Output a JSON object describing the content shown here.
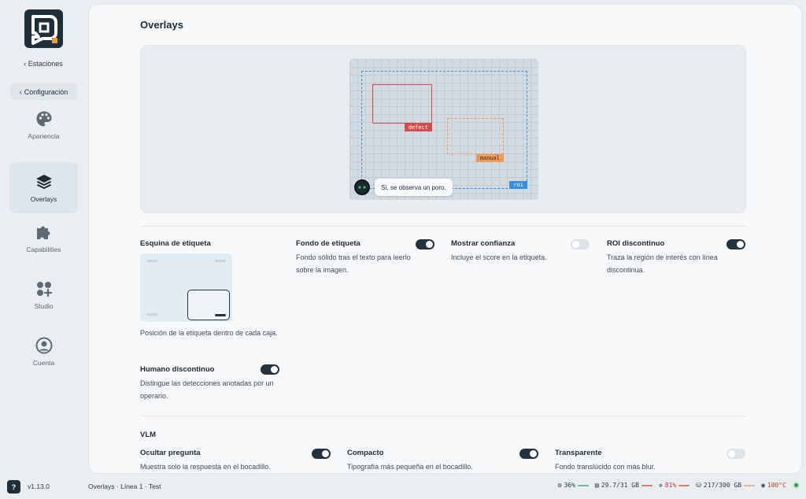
{
  "sidebar": {
    "back_label": "Estaciones",
    "config_label": "Configuración",
    "items": [
      {
        "label": "Apariencia",
        "icon": "palette-icon"
      },
      {
        "label": "Overlays",
        "icon": "layers-icon",
        "active": true
      },
      {
        "label": "Capabilities",
        "icon": "puzzle-icon"
      },
      {
        "label": "Studio",
        "icon": "grid-plus-icon"
      },
      {
        "label": "Cuenta",
        "icon": "user-circle-icon"
      }
    ]
  },
  "main": {
    "title": "Overlays",
    "preview": {
      "defect_tag": "defect",
      "manual_tag": "manual",
      "roi_tag": "roi",
      "vlm_bubble": "Sí, se observa un poro."
    },
    "settings": {
      "corner": {
        "label": "Esquina de etiqueta",
        "desc": "Posición de la etiqueta dentro de cada caja."
      },
      "label_bg": {
        "label": "Fondo de etiqueta",
        "desc": "Fondo sólido tras el texto para leerlo sobre la imagen.",
        "on": true
      },
      "confidence": {
        "label": "Mostrar confianza",
        "desc": "Incluye el score en la etiqueta.",
        "on": false
      },
      "roi_dashed": {
        "label": "ROI discontinuo",
        "desc": "Traza la región de interés con línea discontinua.",
        "on": true
      },
      "human_dashed": {
        "label": "Humano discontinuo",
        "desc": "Distingue las detecciones anotadas por un operario.",
        "on": true
      }
    },
    "vlm": {
      "title": "VLM",
      "hide_question": {
        "label": "Ocultar pregunta",
        "desc": "Muestra solo la respuesta en el bocadillo.",
        "on": true
      },
      "compact": {
        "label": "Compacto",
        "desc": "Tipografía más pequeña en el bocadillo.",
        "on": true
      },
      "transparent": {
        "label": "Transparente",
        "desc": "Fondo translúcido con más blur.",
        "on": false
      }
    }
  },
  "footer": {
    "version": "v1.13.0",
    "breadcrumb": "Overlays · Línea 1 · Test",
    "cpu": "36%",
    "ram": "29.7/31 GB",
    "gpu": "81%",
    "disk": "217/300 GB",
    "temp": "100°C"
  },
  "colors": {
    "accent": "#24323d",
    "defect": "#d84b4b",
    "manual": "#ef9a5a",
    "roi": "#3b8fd9",
    "status_ok": "#2fa24a"
  }
}
